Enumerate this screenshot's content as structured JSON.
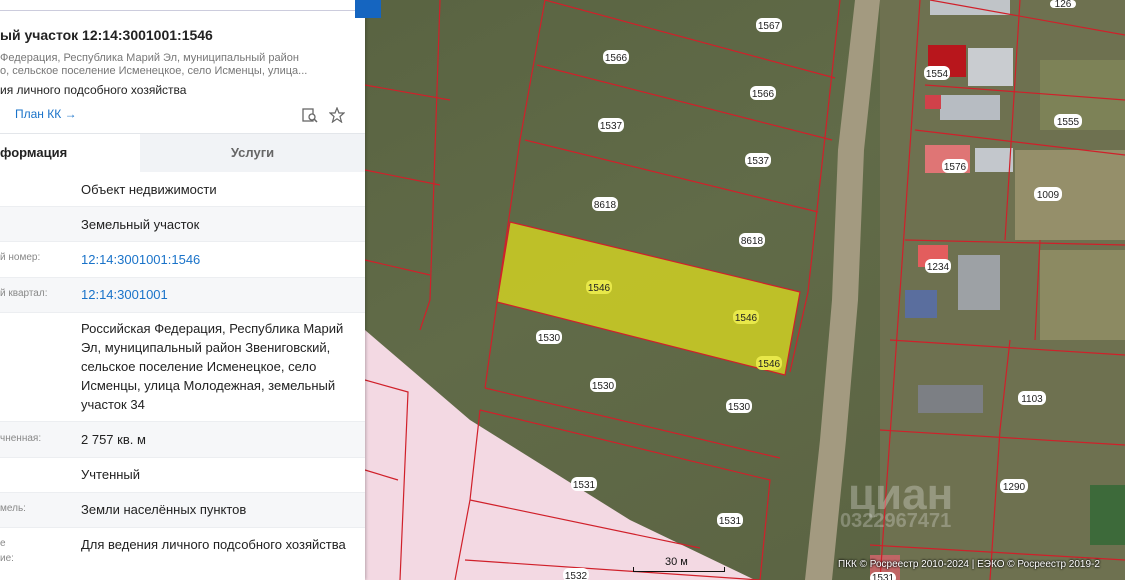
{
  "panel": {
    "title": "ый участок 12:14:3001001:1546",
    "subtitle_line1": "Федерация, Республика Марий Эл, муниципальный район",
    "subtitle_line2": "о, сельское поселение Исменецкое, село Исменцы, улица...",
    "purpose": "ия личного подсобного хозяйства",
    "plan_link": "План КК →",
    "tab_info": "формация",
    "tab_services": "Услуги",
    "rows": [
      {
        "label": "",
        "value": "Объект недвижимости"
      },
      {
        "label": "",
        "value": "Земельный участок"
      },
      {
        "label": "й номер:",
        "value": "12:14:3001001:1546"
      },
      {
        "label": "й квартал:",
        "value": "12:14:3001001"
      },
      {
        "label": "",
        "value": "Российская Федерация, Республика Марий Эл, муниципальный район Звениговский, сельское поселение Исменецкое, село Исменцы, улица Молодежная, земельный участок 34"
      },
      {
        "label": "чненная:",
        "value": "2 757 кв. м"
      },
      {
        "label": "",
        "value": "Учтенный"
      },
      {
        "label": "мель:",
        "value": "Земли населённых пунктов"
      },
      {
        "label_line1": "е",
        "label_line2": "ие:",
        "value": "Для ведения личного подсобного хозяйства"
      }
    ]
  },
  "map": {
    "parcel_labels": {
      "p1567": "1567",
      "p1566a": "1566",
      "p1566b": "1566",
      "p1537a": "1537",
      "p1537b": "1537",
      "p8618a": "8618",
      "p8618b": "8618",
      "p1546a": "1546",
      "p1546b": "1546",
      "p1546c": "1546",
      "p1530a": "1530",
      "p1530b": "1530",
      "p1530c": "1530",
      "p1531a": "1531",
      "p1531b": "1531",
      "p1532": "1532",
      "p1554": "1554",
      "p1555": "1555",
      "p1576": "1576",
      "p1009": "1009",
      "p1234": "1234",
      "p1103": "1103",
      "p1290": "1290",
      "p126": "126",
      "p1531c": "1531"
    },
    "scale_label": "30 м",
    "attribution": "ПКК © Росреестр 2010-2024 | ЕЭКО © Росреестр 2019-2",
    "watermark": "циан",
    "watermark_id": "0322967471",
    "colors": {
      "highlight": "#d8d820",
      "boundary": "#d0202a",
      "zone": "#f3d9e3"
    }
  }
}
